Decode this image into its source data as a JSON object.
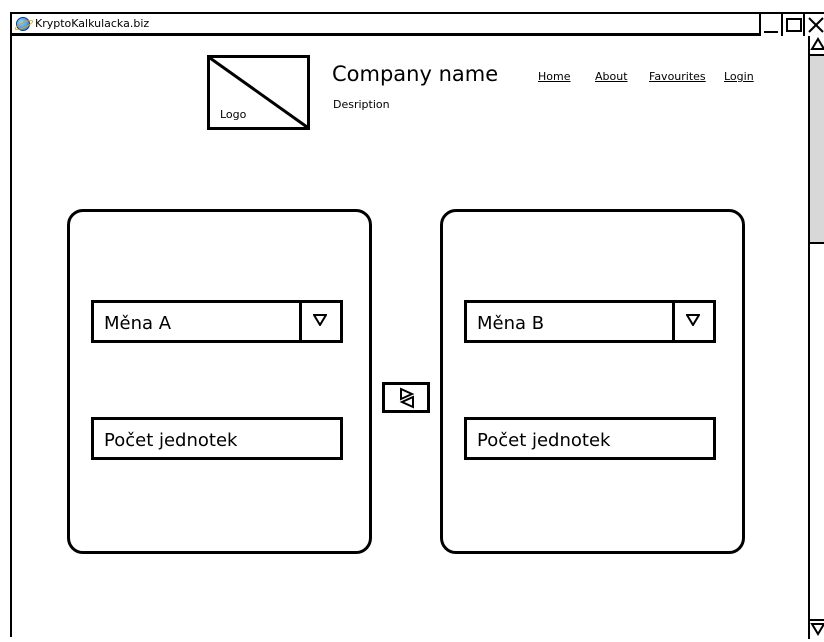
{
  "window": {
    "title": "KryptoKalkulacka.biz",
    "icon": "browser-globe-icon"
  },
  "header": {
    "logo_label": "Logo",
    "company_name": "Company name",
    "description": "Desription",
    "nav": [
      {
        "label": "Home"
      },
      {
        "label": "About"
      },
      {
        "label": "Favourites"
      },
      {
        "label": "Login"
      }
    ]
  },
  "converter": {
    "left": {
      "currency_select": "Měna A",
      "units_input": "Počet jednotek"
    },
    "right": {
      "currency_select": "Měna B",
      "units_input": "Počet jednotek"
    },
    "swap_icon": "swap-arrows-icon"
  }
}
